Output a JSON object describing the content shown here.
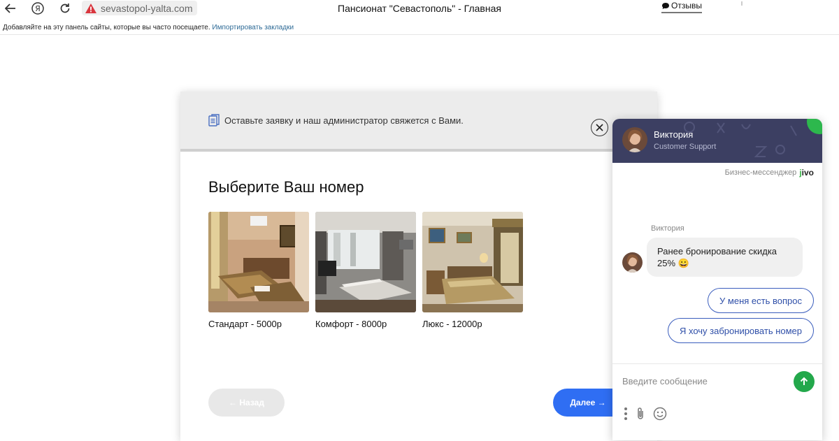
{
  "browser": {
    "address": "sevastopol-yalta.com",
    "page_title": "Пансионат \"Севастополь\" - Главная",
    "reviews_label": "Отзывы",
    "bookmarks_hint": "Добавляйте на эту панель сайты, которые вы часто посещаете.",
    "import_bookmarks": "Импортировать закладки"
  },
  "modal": {
    "notice": "Оставьте заявку и наш администратор свяжется с Вами.",
    "heading": "Выберите Ваш номер",
    "rooms": [
      {
        "label": "Стандарт - 5000р"
      },
      {
        "label": "Комфорт - 8000р"
      },
      {
        "label": "Люкс - 12000р"
      }
    ],
    "back_label": "← Назад",
    "next_label": "Далее →"
  },
  "chat": {
    "agent_name": "Виктория",
    "agent_role": "Customer Support",
    "brand_text": "Бизнес-мессенджер",
    "brand_logo": "jivo",
    "message_sender": "Виктория",
    "message_text": "Ранее бронирование скидка 25% 😀",
    "quick_replies": [
      "У меня есть вопрос",
      "Я хочу забронировать номер"
    ],
    "input_placeholder": "Введите сообщение"
  },
  "colors": {
    "primary_button": "#2f6ef3",
    "chat_header": "#3c3f62",
    "online": "#2db84d",
    "send": "#23a84b",
    "quick_reply_border": "#3a5dbd"
  }
}
